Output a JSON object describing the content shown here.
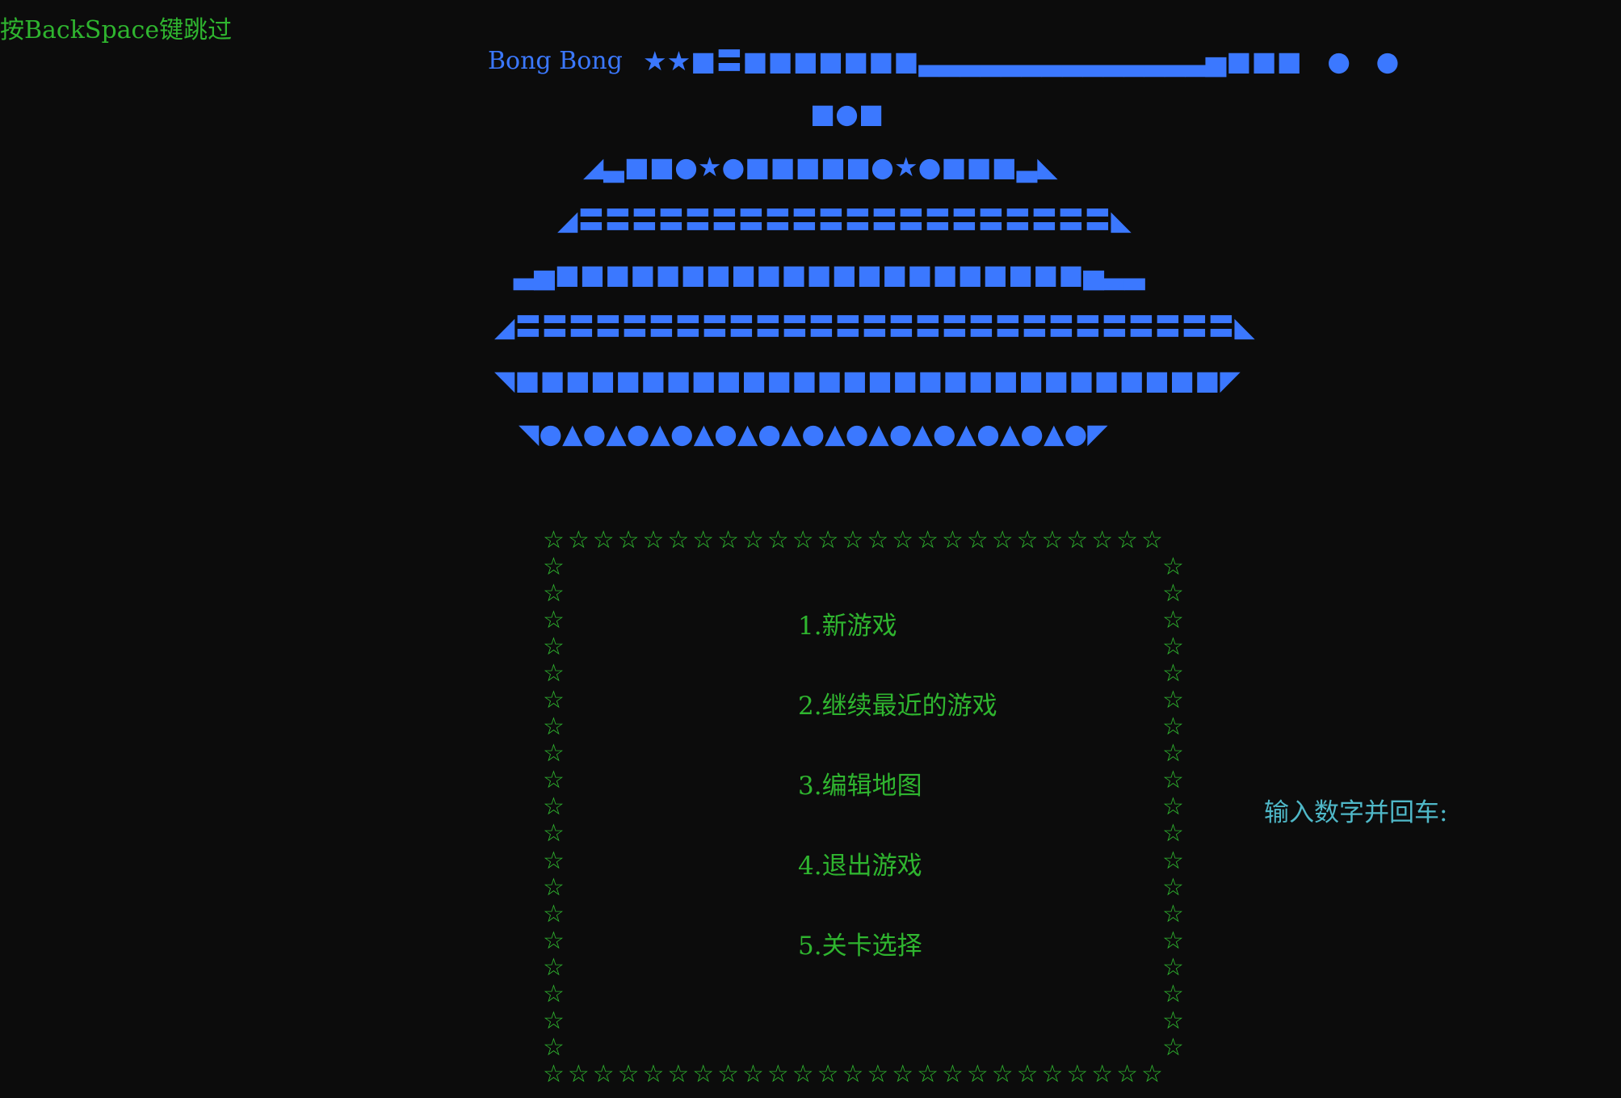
{
  "hint": "按BackSpace键跳过",
  "title": "Bong Bong",
  "ship": {
    "rows": [
      "★★■〓■■■■■■■▃▃▃▃▃▃▃▃▃▃▃▃▃▃▅■■■   ●   ●",
      "■●■",
      "◢▃■■●★●■■■■■●★●■■■▃◣",
      "◢〓〓〓〓〓〓〓〓〓〓〓〓〓〓〓〓〓〓〓〓◣",
      "▃▅■■■■■■■■■■■■■■■■■■■■■▅▃▃",
      "◢〓〓〓〓〓〓〓〓〓〓〓〓〓〓〓〓〓〓〓〓〓〓〓〓〓〓〓◣",
      "◥■■■■■■■■■■■■■■■■■■■■■■■■■■■■◤",
      "◥●▲●▲●▲●▲●▲●▲●▲●▲●▲●▲●▲●▲●◤"
    ]
  },
  "menu": {
    "items": [
      "1.新游戏",
      "2.继续最近的游戏",
      "3.编辑地图",
      "4.退出游戏",
      "5.关卡选择"
    ]
  },
  "prompt": "输入数字并回车:",
  "border_char": "☆",
  "colors": {
    "background": "#0c0c0c",
    "ship_blue": "#3b78ff",
    "menu_green": "#2fb52f",
    "prompt_cyan": "#4fb8c8"
  }
}
